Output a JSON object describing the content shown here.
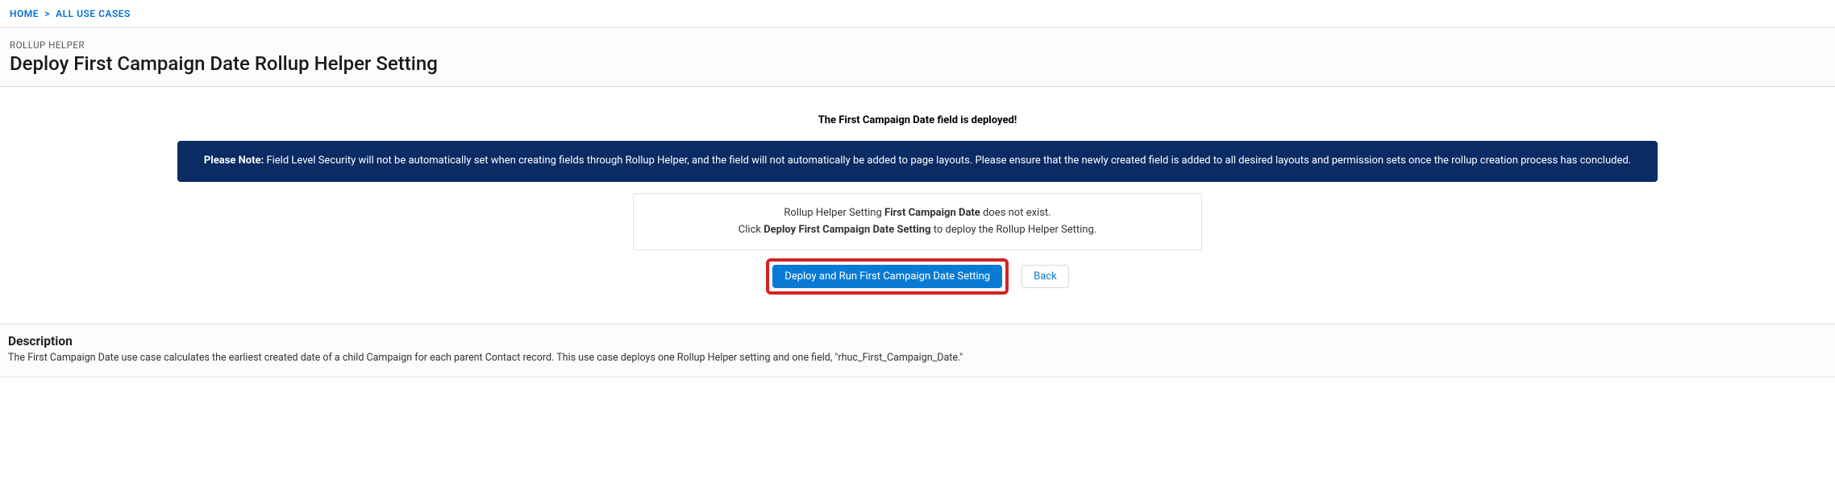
{
  "breadcrumb": {
    "home": "HOME",
    "all_use_cases": "ALL USE CASES",
    "separator": ">"
  },
  "header": {
    "eyebrow": "ROLLUP HELPER",
    "title": "Deploy First Campaign Date Rollup Helper Setting"
  },
  "deployed_msg": "The First Campaign Date field is deployed!",
  "note": {
    "label": "Please Note:",
    "text": " Field Level Security will not be automatically set when creating fields through Rollup Helper, and the field will not automatically be added to page layouts. Please ensure that the newly created field is added to all desired layouts and permission sets once the rollup creation process has concluded."
  },
  "card": {
    "line1_pre": "Rollup Helper Setting ",
    "line1_bold": "First Campaign Date",
    "line1_post": " does not exist.",
    "line2_pre": "Click ",
    "line2_bold": "Deploy First Campaign Date Setting",
    "line2_post": " to deploy the Rollup Helper Setting."
  },
  "buttons": {
    "deploy": "Deploy and Run First Campaign Date Setting",
    "back": "Back"
  },
  "description": {
    "title": "Description",
    "body": "The First Campaign Date use case calculates the earliest created date of a child Campaign for each parent Contact record. This use case deploys one Rollup Helper setting and one field, \"rhuc_First_Campaign_Date.\""
  }
}
